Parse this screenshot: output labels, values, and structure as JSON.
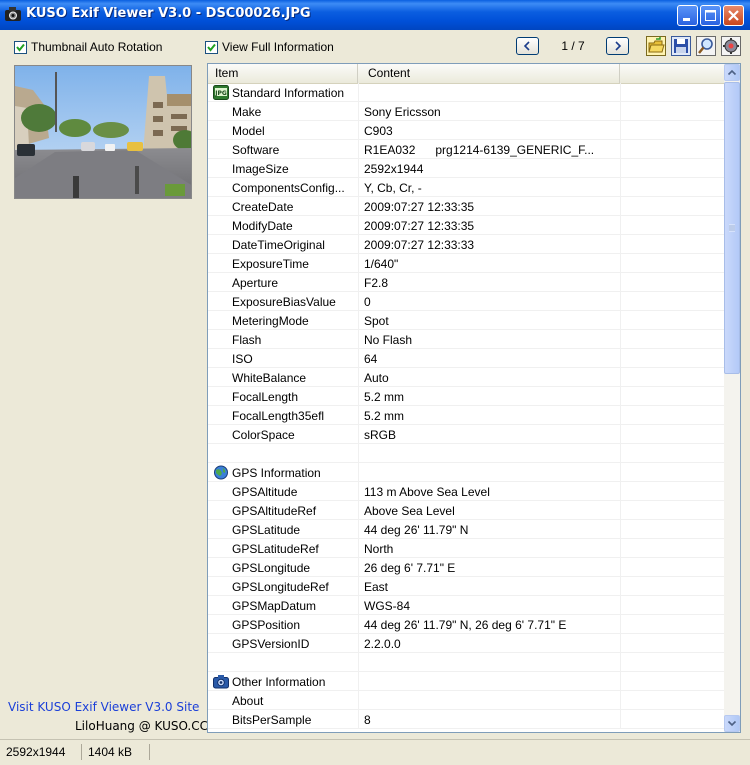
{
  "window": {
    "title": "KUSO Exif Viewer V3.0 - DSC00026.JPG",
    "icon": "camera-app-icon"
  },
  "toolbar": {
    "thumbnail_auto_rotation": {
      "label": "Thumbnail Auto Rotation",
      "checked": true
    },
    "view_full_information": {
      "label": "View Full Information",
      "checked": true
    },
    "page_counter": "1 / 7",
    "icons": [
      "open-folder-icon",
      "save-icon",
      "search-icon",
      "settings-icon"
    ]
  },
  "list": {
    "columns": [
      "Item",
      "Content"
    ],
    "rows": [
      {
        "type": "section",
        "icon": "exif-icon",
        "name": "Standard Information",
        "value": ""
      },
      {
        "name": "Make",
        "value": "Sony Ericsson"
      },
      {
        "name": "Model",
        "value": "C903"
      },
      {
        "name": "Software",
        "value": "R1EA032      prg1214-6139_GENERIC_F..."
      },
      {
        "name": "ImageSize",
        "value": "2592x1944"
      },
      {
        "name": "ComponentsConfig...",
        "value": "Y, Cb, Cr, -"
      },
      {
        "name": "CreateDate",
        "value": "2009:07:27 12:33:35"
      },
      {
        "name": "ModifyDate",
        "value": "2009:07:27 12:33:35"
      },
      {
        "name": "DateTimeOriginal",
        "value": "2009:07:27 12:33:33"
      },
      {
        "name": "ExposureTime",
        "value": "1/640\""
      },
      {
        "name": "Aperture",
        "value": "F2.8"
      },
      {
        "name": "ExposureBiasValue",
        "value": "0"
      },
      {
        "name": "MeteringMode",
        "value": "Spot"
      },
      {
        "name": "Flash",
        "value": "No Flash"
      },
      {
        "name": "ISO",
        "value": "64"
      },
      {
        "name": "WhiteBalance",
        "value": "Auto"
      },
      {
        "name": "FocalLength",
        "value": "5.2 mm"
      },
      {
        "name": "FocalLength35efl",
        "value": "5.2 mm"
      },
      {
        "name": "ColorSpace",
        "value": "sRGB"
      },
      {
        "type": "blank",
        "name": "",
        "value": ""
      },
      {
        "type": "section",
        "icon": "gps-globe-icon",
        "name": "GPS Information",
        "value": ""
      },
      {
        "name": "GPSAltitude",
        "value": "113 m Above Sea Level"
      },
      {
        "name": "GPSAltitudeRef",
        "value": "Above Sea Level"
      },
      {
        "name": "GPSLatitude",
        "value": "44 deg 26' 11.79\" N"
      },
      {
        "name": "GPSLatitudeRef",
        "value": "North"
      },
      {
        "name": "GPSLongitude",
        "value": "26 deg 6' 7.71\" E"
      },
      {
        "name": "GPSLongitudeRef",
        "value": "East"
      },
      {
        "name": "GPSMapDatum",
        "value": "WGS-84"
      },
      {
        "name": "GPSPosition",
        "value": "44 deg 26' 11.79\" N, 26 deg 6' 7.71\" E"
      },
      {
        "name": "GPSVersionID",
        "value": "2.2.0.0"
      },
      {
        "type": "blank",
        "name": "",
        "value": ""
      },
      {
        "type": "section",
        "icon": "camera-icon",
        "name": "Other Information",
        "value": ""
      },
      {
        "name": "About",
        "value": ""
      },
      {
        "name": "BitsPerSample",
        "value": "8"
      }
    ]
  },
  "sidebar": {
    "site_link": "Visit KUSO Exif Viewer V3.0 Site",
    "credit": "LiloHuang @ KUSO.CC"
  },
  "statusbar": {
    "dimensions": "2592x1944",
    "filesize": "1404 kB"
  }
}
